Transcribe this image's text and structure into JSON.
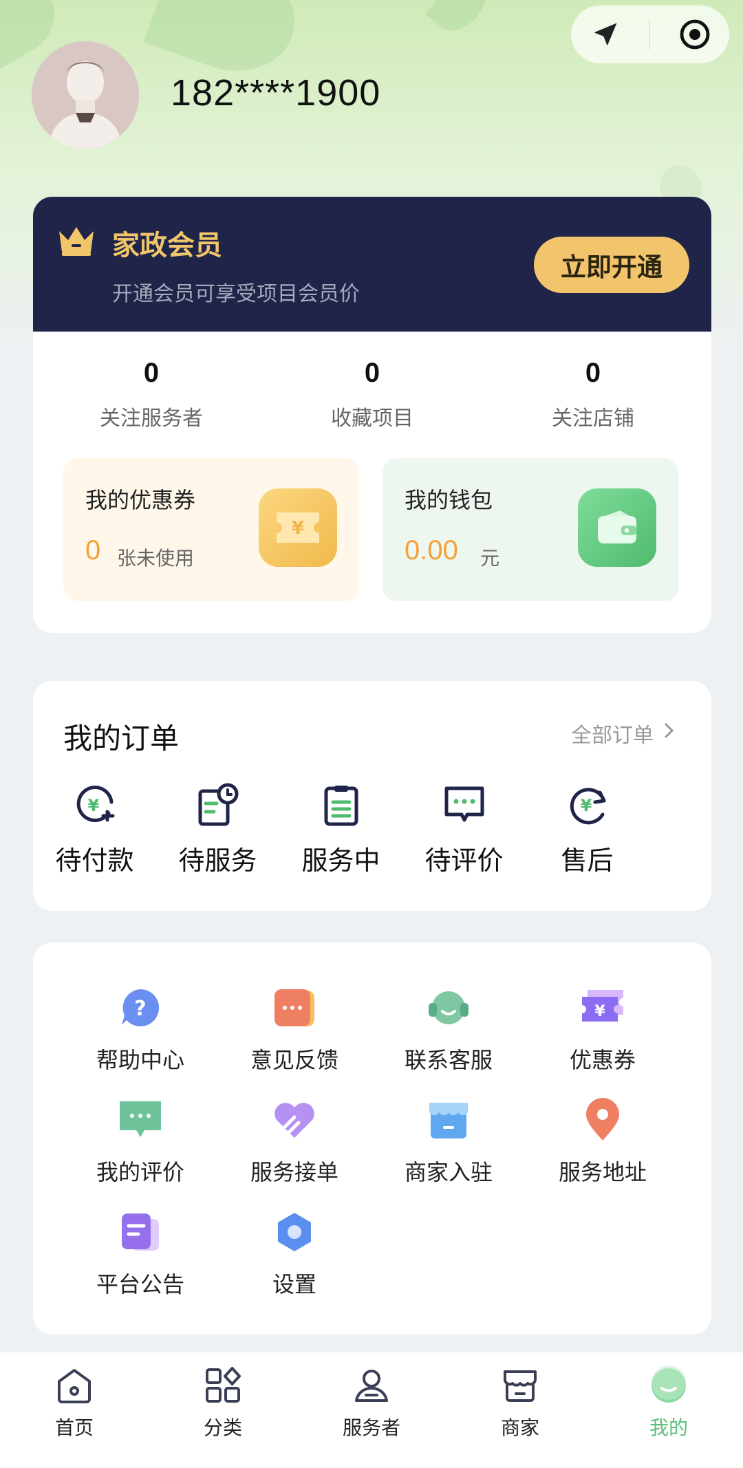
{
  "header": {
    "phone": "182****1900",
    "avatar_icon": "avatar-placeholder",
    "capsule": {
      "left_icon": "location-arrow-icon",
      "right_icon": "target-icon"
    }
  },
  "membership": {
    "title": "家政会员",
    "subtitle": "开通会员可享受项目会员价",
    "button": "立即开通",
    "accent": "#f2c46c",
    "background": "#1f2448"
  },
  "stats": [
    {
      "value": "0",
      "label": "关注服务者"
    },
    {
      "value": "0",
      "label": "收藏项目"
    },
    {
      "value": "0",
      "label": "关注店铺"
    }
  ],
  "coupon_card": {
    "title": "我的优惠券",
    "value": "0",
    "unit": "张未使用",
    "icon": "coupon-icon"
  },
  "wallet_card": {
    "title": "我的钱包",
    "value": "0.00",
    "unit": "元",
    "icon": "wallet-icon"
  },
  "orders": {
    "title": "我的订单",
    "all_link": "全部订单",
    "items": [
      {
        "label": "待付款",
        "icon": "pending-payment-icon"
      },
      {
        "label": "待服务",
        "icon": "pending-service-icon"
      },
      {
        "label": "服务中",
        "icon": "in-service-icon"
      },
      {
        "label": "待评价",
        "icon": "pending-review-icon"
      },
      {
        "label": "售后",
        "icon": "after-sales-icon"
      }
    ]
  },
  "tools": [
    {
      "label": "帮助中心",
      "icon": "help-icon"
    },
    {
      "label": "意见反馈",
      "icon": "feedback-icon"
    },
    {
      "label": "联系客服",
      "icon": "customer-service-icon"
    },
    {
      "label": "优惠券",
      "icon": "coupon-icon"
    },
    {
      "label": "我的评价",
      "icon": "review-icon"
    },
    {
      "label": "服务接单",
      "icon": "accept-order-icon"
    },
    {
      "label": "商家入驻",
      "icon": "merchant-join-icon"
    },
    {
      "label": "服务地址",
      "icon": "location-pin-icon"
    },
    {
      "label": "平台公告",
      "icon": "announcement-icon"
    },
    {
      "label": "设置",
      "icon": "settings-icon"
    }
  ],
  "tabbar": [
    {
      "label": "首页",
      "icon": "home-icon"
    },
    {
      "label": "分类",
      "icon": "category-icon"
    },
    {
      "label": "服务者",
      "icon": "worker-icon"
    },
    {
      "label": "商家",
      "icon": "store-icon"
    },
    {
      "label": "我的",
      "icon": "profile-icon",
      "active": true
    }
  ],
  "colors": {
    "active_tab": "#5bbf7a",
    "amount": "#f2a13b"
  }
}
